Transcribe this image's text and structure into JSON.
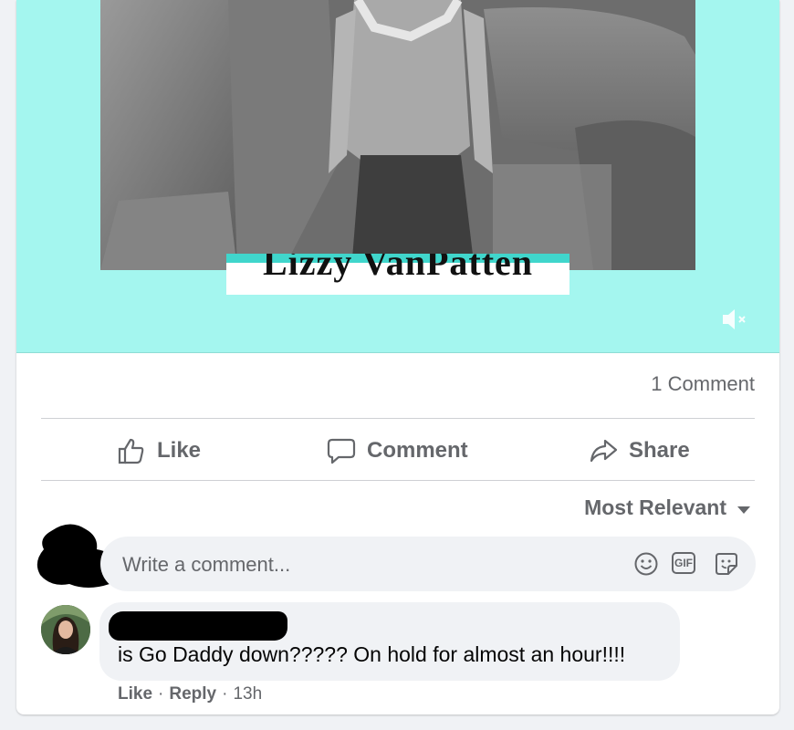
{
  "post": {
    "video_caption": "Lizzy VanPatten",
    "comment_count": "1 Comment",
    "actions": {
      "like": "Like",
      "comment": "Comment",
      "share": "Share"
    },
    "sort_label": "Most Relevant"
  },
  "composer": {
    "placeholder": "Write a comment...",
    "gif_label": "GIF"
  },
  "comments": [
    {
      "text": "is Go Daddy down????? On hold for almost an hour!!!!",
      "like": "Like",
      "reply": "Reply",
      "time": "13h"
    }
  ],
  "colors": {
    "video_background": "#a4f6ef",
    "caption_accent": "#40d6cc",
    "secondary_text": "#65676b",
    "divider": "#ced0d4",
    "bubble": "#f0f2f5"
  },
  "icons": [
    "mute-icon",
    "like-icon",
    "comment-icon",
    "share-icon",
    "chevron-down-icon",
    "emoji-icon",
    "gif-icon",
    "sticker-icon"
  ]
}
